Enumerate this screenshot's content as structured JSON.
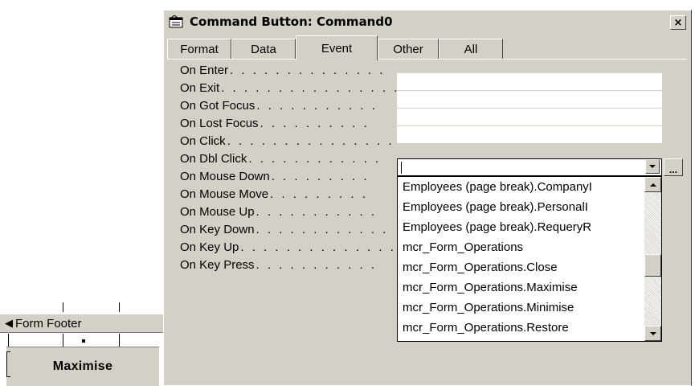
{
  "designer": {
    "section_label": "Form Footer",
    "button_caption": "Maximise"
  },
  "dialog": {
    "title": "Command Button: Command0",
    "close_glyph": "×",
    "tabs": [
      {
        "label": "Format"
      },
      {
        "label": "Data"
      },
      {
        "label": "Event"
      },
      {
        "label": "Other"
      },
      {
        "label": "All"
      }
    ],
    "active_tab": "Event",
    "properties": [
      {
        "label": "On Enter",
        "dots": ". . . . . . . . . . . . . ."
      },
      {
        "label": "On Exit",
        "dots": ". . . . . . . . . . . . . . . ."
      },
      {
        "label": "On Got Focus",
        "dots": ". . . . . . . . . . ."
      },
      {
        "label": "On Lost Focus",
        "dots": ". . . . . . . . . ."
      },
      {
        "label": "On Click",
        "dots": ". . . . . . . . . . . . . . ."
      },
      {
        "label": "On Dbl Click",
        "dots": ". . . . . . . . . . . ."
      },
      {
        "label": "On Mouse Down",
        "dots": ". . . . . . . . ."
      },
      {
        "label": "On Mouse Move",
        "dots": ". . . . . . . . ."
      },
      {
        "label": "On Mouse Up",
        "dots": ". . . . . . . . . . ."
      },
      {
        "label": "On Key Down",
        "dots": ". . . . . . . . . . . ."
      },
      {
        "label": "On Key Up",
        "dots": ". . . . . . . . . . . . . ."
      },
      {
        "label": "On Key Press",
        "dots": ". . . . . . . . . . ."
      }
    ],
    "on_click_value": "",
    "build_glyph": "...",
    "dropdown_items": [
      "Employees (page break).CompanyI",
      "Employees (page break).PersonalI",
      "Employees (page break).RequeryR",
      "mcr_Form_Operations",
      "mcr_Form_Operations.Close",
      "mcr_Form_Operations.Maximise",
      "mcr_Form_Operations.Minimise",
      "mcr_Form_Operations.Restore"
    ]
  }
}
